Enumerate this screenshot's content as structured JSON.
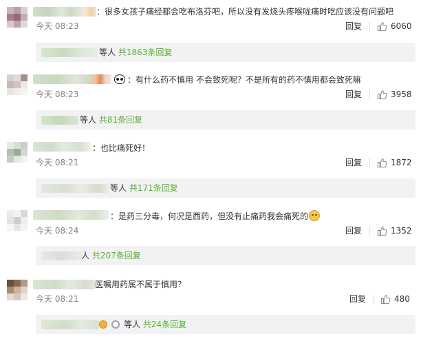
{
  "colors": {
    "text": "#333333",
    "muted": "#808080",
    "link_green": "#56b22b",
    "reply_bg": "#f2f2f5"
  },
  "comments": [
    {
      "text": "：很多女孩子痛经都会吃布洛芬吧，所以没有发烧头疼喉咙痛时吃应该没有问题吧",
      "time": "今天 08:23",
      "reply_label": "回复",
      "like_icon": "thumbs-up-icon",
      "likes": "6060",
      "sub": {
        "prefix": "等人",
        "count_text": "共1863条回复"
      }
    },
    {
      "emoji": "panda-icon",
      "text": "：有什么药不慎用 不会致死呢？不是所有的药不慎用都会致死嘛",
      "time": "今天 08:23",
      "reply_label": "回复",
      "like_icon": "thumbs-up-icon",
      "likes": "3958",
      "sub": {
        "prefix": "等人",
        "count_text": "共81条回复"
      }
    },
    {
      "text": "：也比痛死好！",
      "time": "今天 08:21",
      "reply_label": "回复",
      "like_icon": "thumbs-up-icon",
      "likes": "1872",
      "sub": {
        "prefix": "等人",
        "count_text": "共171条回复"
      }
    },
    {
      "text": "：是药三分毒，何况是西药，但没有止痛药我会痛死的",
      "emoji": "smiley-icon",
      "time": "今天 08:24",
      "reply_label": "回复",
      "like_icon": "thumbs-up-icon",
      "likes": "1352",
      "sub": {
        "prefix": "人",
        "count_text": "共207条回复"
      }
    },
    {
      "text": "医嘱用药属不属于慎用？",
      "time": "今天 08:21",
      "reply_label": "回复",
      "like_icon": "thumbs-up-icon",
      "likes": "480",
      "sub": {
        "prefix": "等人",
        "count_text": "共24条回复"
      }
    }
  ]
}
